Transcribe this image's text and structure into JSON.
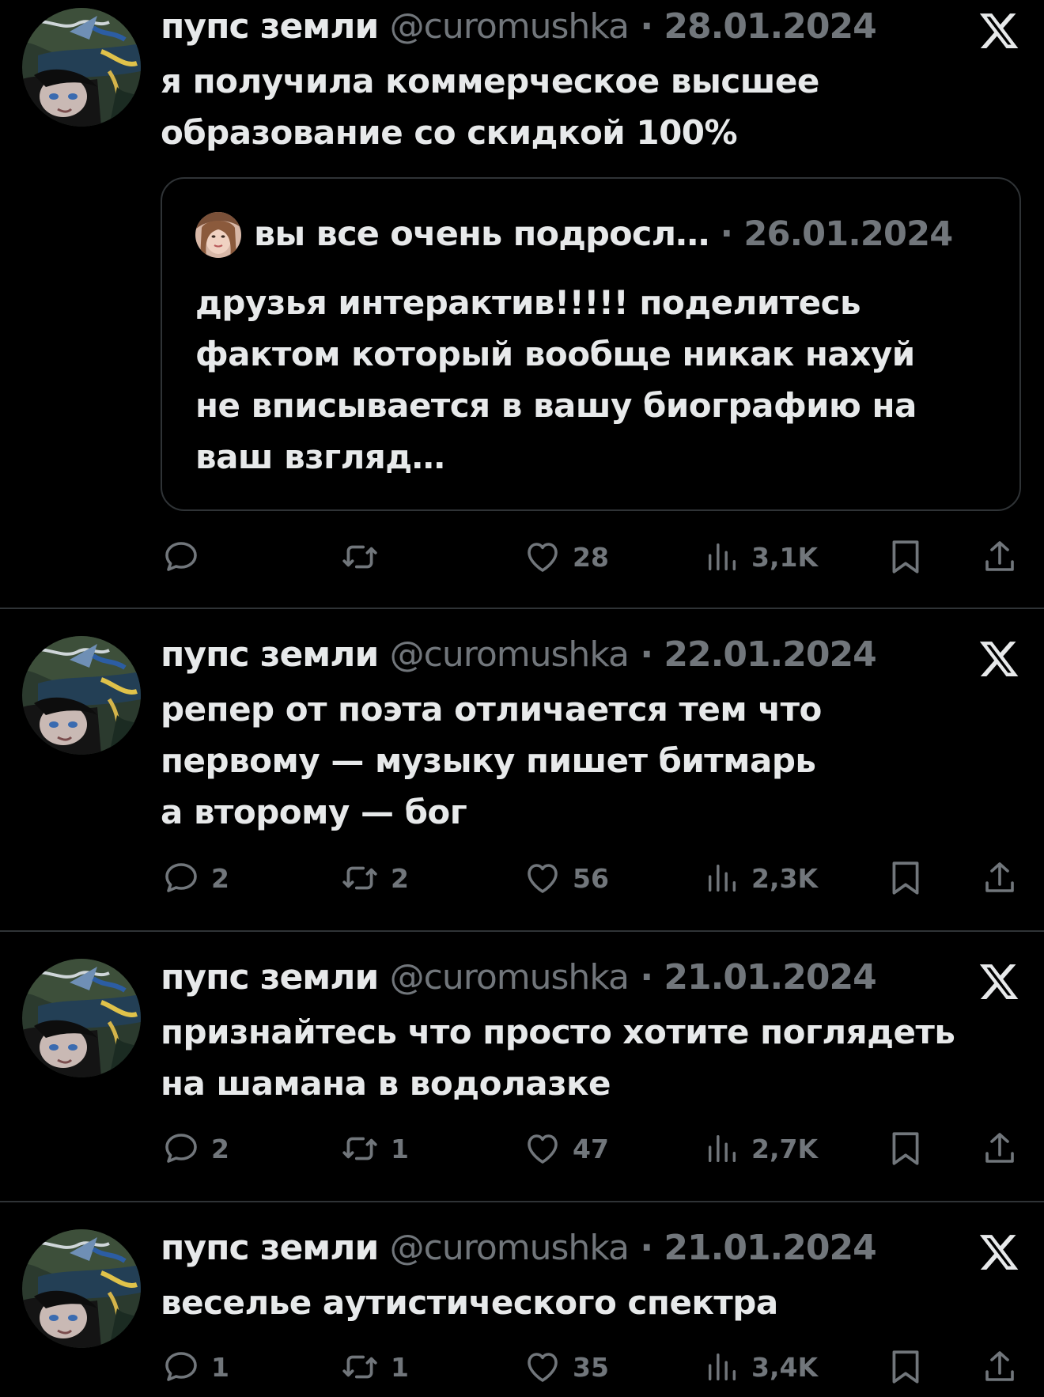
{
  "tweets": [
    {
      "name": "пупс земли",
      "handle": "@curomushka",
      "separator": "·",
      "date": "28.01.2024",
      "lines": [
        "я получила коммерческое высшее",
        "образование со скидкой 100%"
      ],
      "quote": {
        "name": "вы все очень подросл…",
        "separator": "·",
        "date": "26.01.2024",
        "lines": [
          "друзья интерактив!!!!! поделитесь",
          "фактом который вообще никак нахуй",
          "не вписывается в вашу биографию на",
          "ваш взгляд…"
        ]
      },
      "replies": "",
      "retweets": "",
      "likes": "28",
      "views": "3,1K"
    },
    {
      "name": "пупс земли",
      "handle": "@curomushka",
      "separator": "·",
      "date": "22.01.2024",
      "lines": [
        "репер от поэта отличается тем что",
        "первому — музыку пишет битмарь",
        "а второму — бог"
      ],
      "replies": "2",
      "retweets": "2",
      "likes": "56",
      "views": "2,3K"
    },
    {
      "name": "пупс земли",
      "handle": "@curomushka",
      "separator": "·",
      "date": "21.01.2024",
      "lines": [
        "признайтесь что просто хотите поглядеть",
        "на шамана в водолазке"
      ],
      "replies": "2",
      "retweets": "1",
      "likes": "47",
      "views": "2,7K"
    },
    {
      "name": "пупс земли",
      "handle": "@curomushka",
      "separator": "·",
      "date": "21.01.2024",
      "lines": [
        "веселье аутистического спектра"
      ],
      "replies": "1",
      "retweets": "1",
      "likes": "35",
      "views": "3,4K"
    }
  ],
  "icons": {
    "reply": "reply-icon",
    "retweet": "retweet-icon",
    "like": "heart-icon",
    "views": "views-icon",
    "bookmark": "bookmark-icon",
    "share": "share-icon",
    "logo": "x-logo-icon"
  },
  "colors": {
    "background": "#000000",
    "primary_text": "#e7e9ea",
    "secondary_text": "#71767b",
    "border": "#2f3336"
  }
}
